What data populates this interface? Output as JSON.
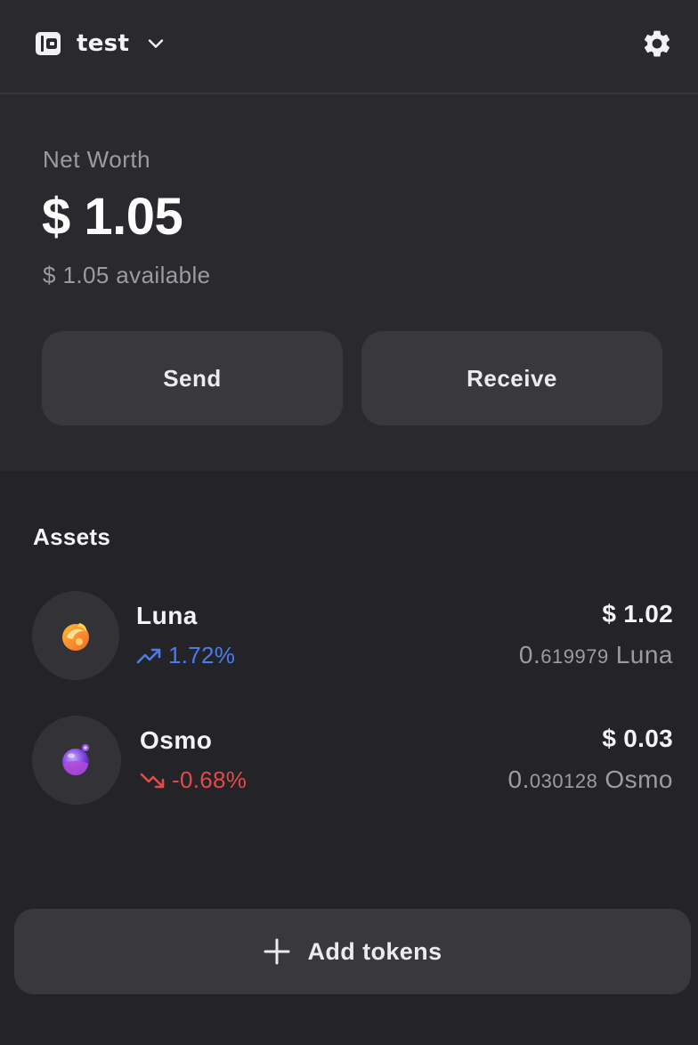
{
  "header": {
    "wallet_name": "test",
    "icons": {
      "wallet": "wallet-icon",
      "dropdown": "chevron-down-icon",
      "settings": "gear-icon"
    }
  },
  "net_worth": {
    "label": "Net Worth",
    "value": "$ 1.05",
    "available": "$ 1.05 available"
  },
  "actions": {
    "send_label": "Send",
    "receive_label": "Receive"
  },
  "assets": {
    "title": "Assets",
    "items": [
      {
        "name": "Luna",
        "change": "1.72%",
        "direction": "up",
        "usd": "$ 1.02",
        "amount_int": "0.",
        "amount_dec": "619979",
        "symbol": "Luna",
        "icon": "luna-token-icon"
      },
      {
        "name": "Osmo",
        "change": "-0.68%",
        "direction": "down",
        "usd": "$ 0.03",
        "amount_int": "0.",
        "amount_dec": "030128",
        "symbol": "Osmo",
        "icon": "osmo-token-icon"
      }
    ]
  },
  "add_tokens": {
    "label": "Add tokens",
    "icon": "plus-icon"
  },
  "colors": {
    "background": "#242428",
    "panel": "#2a2a2e",
    "button": "#38383d",
    "positive": "#4a7cf0",
    "negative": "#e24a4a",
    "muted_text": "#9b9ba2"
  }
}
